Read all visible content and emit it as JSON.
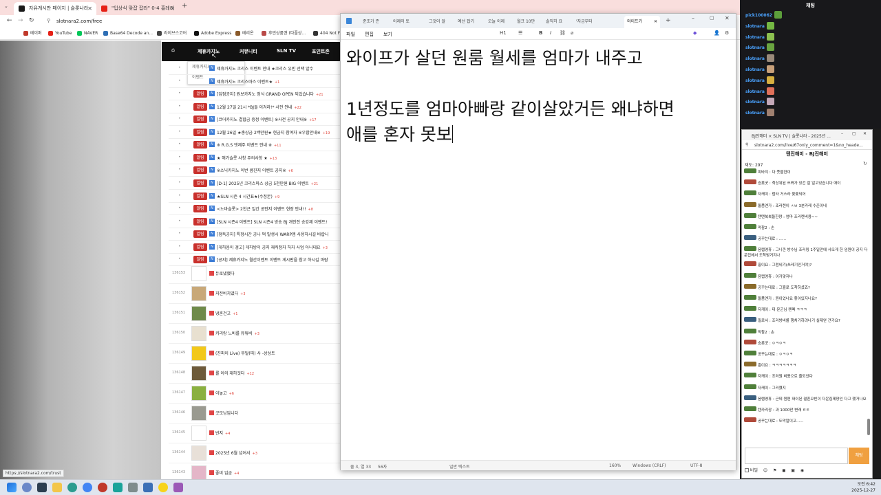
{
  "browser": {
    "tabs": [
      {
        "label": "자유게시판 페이지 | 슬롯나라",
        "active": true
      },
      {
        "label": "\"입상식 맞잡 잡라\" 0-4 홍레리",
        "active": false
      }
    ],
    "new_tab": "+",
    "address": "slotnara2.com/free",
    "bookmarks": [
      "테이퍼",
      "YouTube",
      "NAVER",
      "Base64 Decode an...",
      "라이브스코어",
      "Adobe Express",
      "테리온",
      "후민상품권 (타플상...",
      "404 Not F"
    ]
  },
  "site": {
    "nav": [
      "제휴카지노",
      "커뮤니티",
      "SLN TV",
      "포인트존"
    ],
    "dropdown": [
      "제휴카지노",
      "이벤트"
    ],
    "notices": [
      {
        "title": "제휴카지노 크리스 이벤트 안내 ★크리스 유빈 선택 알수",
        "count": "",
        "badge": false
      },
      {
        "title": "제휴카지노 크리스마스 이벤트★",
        "count": "+1",
        "badge": false
      },
      {
        "title": "[입점공지] 원보카지노 정식 GRAND OPEN 되었습니다",
        "count": "+21",
        "badge": true
      },
      {
        "title": "12월 27일 21시 *BJ들 이겨라!* 사전 안내",
        "count": "+22",
        "badge": true
      },
      {
        "title": "[코어카지노 결합금 증정 이벤트] ※사전 공지 안내※",
        "count": "+17",
        "badge": true
      },
      {
        "title": "12월 26일 ★총상금 2백만원★ 현금지 참여자 ※우합안내※",
        "count": "+19",
        "badge": true
      },
      {
        "title": "※ R.G.S 댓제주 이벤트 안내 ※",
        "count": "+11",
        "badge": true
      },
      {
        "title": "★ 해가슬롯 사칭 주의사항 ★",
        "count": "+13",
        "badge": true
      },
      {
        "title": "※소닉카지노 이번 콤진지 이벤트 공지※",
        "count": "+6",
        "badge": true
      },
      {
        "title": "[D-1] 2025년 크리스마스 상금 5천만원 BIG 이벤트",
        "count": "+21",
        "badge": true
      },
      {
        "title": "★SLN 시즌 4 시간표★(수정본)",
        "count": "+9",
        "badge": true
      },
      {
        "title": "<노바슬롯> 2천근 일간 공안지 이벤트 현장 안내!!",
        "count": "+8",
        "badge": true
      },
      {
        "title": "[SLN 시즌4 이벤트] SLN 시즌4 방송 BJ 개인전 승강제 이벤트!",
        "count": "",
        "badge": true
      },
      {
        "title": "[점독공지] 특정시간 공나 떡 발생시 WARP앱 사용하시길 바랍니",
        "count": "",
        "badge": true
      },
      {
        "title": "[게하음이 경고] 게하방이 공지 재러정자 하자 사업 아니데요",
        "count": "+3",
        "badge": true
      },
      {
        "title": "[공지] 제휴카지노 월간이벤트 이벤트 게시판을 참고 하시길 바람",
        "count": "",
        "badge": true
      }
    ],
    "notice_badge": "알림",
    "posts": [
      {
        "num": "136153",
        "title": "듀로냈했다",
        "count": ""
      },
      {
        "num": "136152",
        "title": "지전비치였다",
        "count": "+3"
      },
      {
        "num": "136151",
        "title": "냉혼건고",
        "count": "+1"
      },
      {
        "num": "136150",
        "title": "키리랑 느바를 뮤튜비",
        "count": "+3"
      },
      {
        "num": "136149",
        "title": "(진퍼이 Live) 무탈(따) 사 -상상트",
        "count": ""
      },
      {
        "num": "136148",
        "title": "롤 이의 재하것다",
        "count": "+12"
      },
      {
        "num": "136147",
        "title": "이놓고",
        "count": "+6"
      },
      {
        "num": "136146",
        "title": "굿모닝입니다",
        "count": ""
      },
      {
        "num": "136145",
        "title": "빈지",
        "count": "+4"
      },
      {
        "num": "136144",
        "title": "2025년 6월 넘어서",
        "count": "+3"
      },
      {
        "num": "136143",
        "title": "좋비 임금",
        "count": "+4"
      }
    ],
    "status_url": "https://slotnara2.com/trust"
  },
  "notepad": {
    "tabs": [
      "준조가 존",
      "어제의 토",
      "그것이 알",
      "예선 잡기",
      "오늘 이제",
      "월크 10만",
      "솔직히 요",
      "'자금부터",
      "와이프가"
    ],
    "menu": [
      "파일",
      "편집",
      "보기"
    ],
    "heading_tool": "H1",
    "lines": [
      "와이프가 살던 원룸 월세를 엄마가 내주고",
      "",
      "1년정도를 엄마아빠랑 같이살았거든 왜냐하면",
      "애를 혼자 못보"
    ],
    "status": {
      "position": "줄 3, 열 33",
      "chars": "56자",
      "format": "일반 텍스트",
      "zoom": "160%",
      "eol": "Windows (CRLF)",
      "encoding": "UTF-8"
    }
  },
  "chat": {
    "title": "채팅",
    "lines": [
      {
        "user": "pick100062",
        "emote_color": "#5c9e3b"
      },
      {
        "user": "slotnara",
        "emote_color": "#74b843"
      },
      {
        "user": "slotnara",
        "emote_color": "#8cc050"
      },
      {
        "user": "slotnara",
        "emote_color": "#6aa440"
      },
      {
        "user": "slotnara",
        "emote_color": "#9a8a7a"
      },
      {
        "user": "slotnara",
        "emote_color": "#c8a07a"
      },
      {
        "user": "slotnara",
        "emote_color": "#d8b040"
      },
      {
        "user": "slotnara",
        "emote_color": "#e0705a"
      },
      {
        "user": "slotnara",
        "emote_color": "#c4a8b8"
      },
      {
        "user": "slotnara",
        "emote_color": "#a08070"
      }
    ]
  },
  "popup": {
    "window_title": "BJ진해미 × SLN TV | 슬롯나라 - 2025년 ...",
    "url": "slotnara2.com/live/67only_comment=1&no_heade...",
    "header": "탠진해미 - BJ진해미",
    "viewers": "재도: 297",
    "messages": [
      "피바지 : 다 풋을한이",
      "승롯굿 : 최상위된 쓰봐가 있건 잘 일고있습니다 애이",
      "자캐이 : 럼타 거스라 윷윷되어",
      "돌품엔가 : 조러렌이 ㅅㅂ 3분카레 수준이네",
      "탠탠복복둘한량 : 엄마 조러렌비용~~",
      "막참2 : 손",
      "공꾸는대로 : ......",
      "음렙영휴 : 그니깐 방수님 조러링 1주일만에 사오게 한 임원이 공지 다운집에서 도착받거지나",
      "홍이요 : 그럼네기(쓰레기인거야)?",
      "음렙영휴 : 이거맞저나",
      "공꾸는대로 : 그뭘로 도착하셨죠?",
      "돌품엔가 : 원이었나요 좋아있지나요?",
      "자캐이 : 대 운군님 렌렉 ㅋㅋㅋ",
      "필로서 : 조러방비를 행치기하려나기 실제얻 건가요?",
      "막참2 : 손",
      "승롯굿 : ㅇㅋㅇㅋ",
      "공꾸는대로 : ㅇㅋㅇㅋ",
      "홍이요 : ㅋㅋㅋㅋㅋㅋㅋ",
      "자캐이 : 조러원 비용으로 줄되었다",
      "자캐이 : 그러켰지",
      "음렙영휴 : 근데 원편 와이된 결혼오빈이 다운집제양인 다고 했거나요",
      "텐카리광 : 과 1000만 변래 ㅌㅌ",
      "공꾸는대로 : 도막알이고......"
    ],
    "send": "채팅",
    "bottom_label": "비밀"
  },
  "taskbar": {
    "time": "오전 6:42",
    "date": "2025-12-27"
  }
}
